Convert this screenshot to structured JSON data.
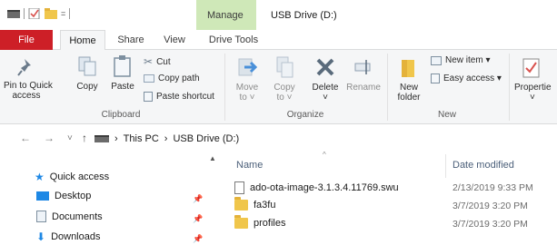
{
  "titlebar": {
    "contextual_tab": "Manage",
    "window_title": "USB Drive (D:)",
    "qat_customize": "="
  },
  "tabs": [
    {
      "label": "File"
    },
    {
      "label": "Home"
    },
    {
      "label": "Share"
    },
    {
      "label": "View"
    },
    {
      "label": "Drive Tools"
    }
  ],
  "ribbon": {
    "clipboard": {
      "group_label": "Clipboard",
      "pin_line1": "Pin to Quick",
      "pin_line2": "access",
      "copy": "Copy",
      "paste": "Paste",
      "cut": "Cut",
      "copy_path": "Copy path",
      "paste_shortcut": "Paste shortcut"
    },
    "organize": {
      "group_label": "Organize",
      "move_to": "Move",
      "move_to2": "to ˅",
      "copy_to": "Copy",
      "copy_to2": "to ˅",
      "delete": "Delete",
      "delete2": "˅",
      "rename": "Rename"
    },
    "new": {
      "group_label": "New",
      "new_folder1": "New",
      "new_folder2": "folder",
      "new_item": "New item ▾",
      "easy_access": "Easy access ▾"
    },
    "open": {
      "properties": "Propertie",
      "properties2": "˅"
    }
  },
  "addressbar": {
    "back": "←",
    "forward": "→",
    "recent": "˅",
    "up": "↑",
    "path": [
      "This PC",
      "USB Drive (D:)"
    ],
    "separator": "›"
  },
  "navpane": {
    "items": [
      {
        "label": "Quick access",
        "icon": "star-icon"
      },
      {
        "label": "Desktop",
        "icon": "desktop-icon"
      },
      {
        "label": "Documents",
        "icon": "documents-icon"
      },
      {
        "label": "Downloads",
        "icon": "downloads-icon"
      }
    ],
    "pin_glyph": "📌"
  },
  "filepane": {
    "columns": {
      "name": "Name",
      "date": "Date modified"
    },
    "sort_caret": "^",
    "rows": [
      {
        "name": "ado-ota-image-3.1.3.4.11769.swu",
        "date": "2/13/2019 9:33 PM",
        "type": "file"
      },
      {
        "name": "fa3fu",
        "date": "3/7/2019 3:20 PM",
        "type": "folder"
      },
      {
        "name": "profiles",
        "date": "3/7/2019 3:20 PM",
        "type": "folder"
      }
    ]
  },
  "colors": {
    "file_tab": "#cd1f27",
    "manage_tab": "#cfe8b8",
    "ribbon_bg": "#f5f6f7",
    "folder": "#f0c64b",
    "accent_blue": "#1e88e5"
  }
}
